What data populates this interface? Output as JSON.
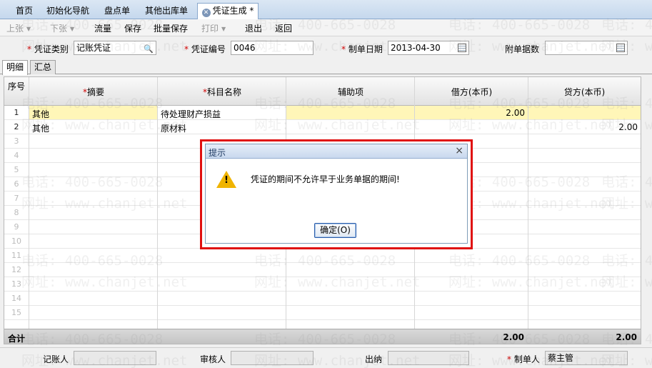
{
  "tabs": [
    {
      "label": "首页",
      "active": false
    },
    {
      "label": "初始化导航",
      "active": false
    },
    {
      "label": "盘点单",
      "active": false
    },
    {
      "label": "其他出库单",
      "active": false
    },
    {
      "label": "凭证生成 *",
      "active": true
    }
  ],
  "toolbar": {
    "prev": "上张",
    "next": "下张",
    "flow": "流量",
    "save": "保存",
    "batch_save": "批量保存",
    "print": "打印",
    "exit": "退出",
    "back": "返回"
  },
  "header": {
    "voucher_type_label": "凭证类别",
    "voucher_type_value": "记账凭证",
    "voucher_no_label": "凭证编号",
    "voucher_no_value": "0046",
    "date_label": "制单日期",
    "date_value": "2013-04-30",
    "attach_label": "附单据数",
    "attach_value": ""
  },
  "detail_tabs": [
    "明细",
    "汇总"
  ],
  "grid": {
    "columns": [
      "序号",
      "摘要",
      "科目名称",
      "辅助项",
      "借方(本币)",
      "贷方(本币)"
    ],
    "rows": [
      {
        "no": "1",
        "summary": "其他",
        "account": "待处理财产损益",
        "aux": "",
        "debit": "2.00",
        "credit": ""
      },
      {
        "no": "2",
        "summary": "其他",
        "account": "原材料",
        "aux": "",
        "debit": "",
        "credit": "2.00"
      },
      {
        "no": "3"
      },
      {
        "no": "4"
      },
      {
        "no": "5"
      },
      {
        "no": "6"
      },
      {
        "no": "7"
      },
      {
        "no": "8"
      },
      {
        "no": "9"
      },
      {
        "no": "10"
      },
      {
        "no": "11"
      },
      {
        "no": "12"
      },
      {
        "no": "13"
      },
      {
        "no": "14"
      },
      {
        "no": "15"
      }
    ],
    "total_label": "合计",
    "total_debit": "2.00",
    "total_credit": "2.00"
  },
  "footer": {
    "bookkeeper_label": "记账人",
    "bookkeeper_value": "",
    "reviewer_label": "审核人",
    "reviewer_value": "",
    "cashier_label": "出纳",
    "cashier_value": "",
    "maker_label": "制单人",
    "maker_value": "蔡主管"
  },
  "dialog": {
    "title": "提示",
    "message": "凭证的期间不允许早于业务单据的期间!",
    "ok_label": "确定(O)",
    "close_symbol": "×"
  },
  "watermark": {
    "phone": "电话: 400-665-0028",
    "site": "网址: www.chanjet.net"
  },
  "colors": {
    "highlight_row": "#fff6b8",
    "dialog_border": "#e01010",
    "required": "#d00000"
  },
  "icons": [
    "search-icon",
    "calendar-icon",
    "warning-icon",
    "close-icon",
    "tab-close-icon"
  ]
}
